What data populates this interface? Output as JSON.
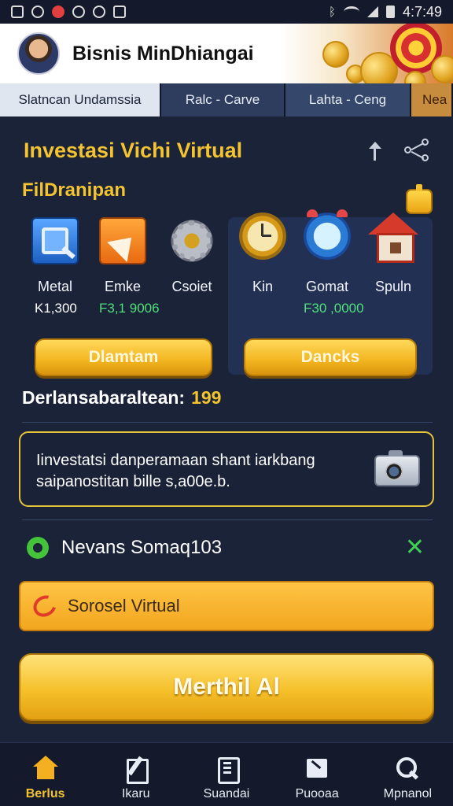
{
  "status_bar": {
    "time": "4:7:49"
  },
  "header": {
    "title": "Bisnis MinDhiangai"
  },
  "tabs": [
    {
      "label": "Slatncan Undamssia"
    },
    {
      "label": "Ralc - Carve"
    },
    {
      "label": "Lahta - Ceng"
    },
    {
      "label": "Nea"
    }
  ],
  "main": {
    "title": "Investasi Vichi Virtual",
    "subtitle": "FilDranipan",
    "left_panel": {
      "items": [
        {
          "name": "Metal",
          "icon": "search-icon"
        },
        {
          "name": "Emke",
          "icon": "paper-plane-icon"
        },
        {
          "name": "Csoiet",
          "icon": "gear-icon"
        }
      ],
      "values": [
        "K1,300",
        "F3,1 9006"
      ],
      "button_label": "Dlamtam"
    },
    "right_panel": {
      "items": [
        {
          "name": "Kin",
          "icon": "clock-icon"
        },
        {
          "name": "Gomat",
          "icon": "alarm-clock-icon"
        },
        {
          "name": "Spuln",
          "icon": "house-icon"
        }
      ],
      "value": "F30 ,0000",
      "button_label": "Dancks"
    },
    "points_label": "Derlansabaraltean:",
    "points_value": "199",
    "info_card": {
      "text": "Iinvestatsi danperamaan shant iarkbang saipanostitan bille s,a00e.b."
    },
    "bonus": {
      "text": "Nevans Somaq103"
    },
    "secondary_button": "Sorosel Virtual",
    "primary_button": "Merthil Al"
  },
  "bottom_nav": [
    {
      "label": "Berlus",
      "icon": "home-icon",
      "active": true
    },
    {
      "label": "Ikaru",
      "icon": "edit-icon",
      "active": false
    },
    {
      "label": "Suandai",
      "icon": "document-icon",
      "active": false
    },
    {
      "label": "Puooaa",
      "icon": "note-icon",
      "active": false
    },
    {
      "label": "Mpnanol",
      "icon": "search-icon",
      "active": false
    }
  ],
  "colors": {
    "accent_gold": "#f4c430",
    "background": "#1b2339",
    "positive_green": "#43c23a"
  }
}
